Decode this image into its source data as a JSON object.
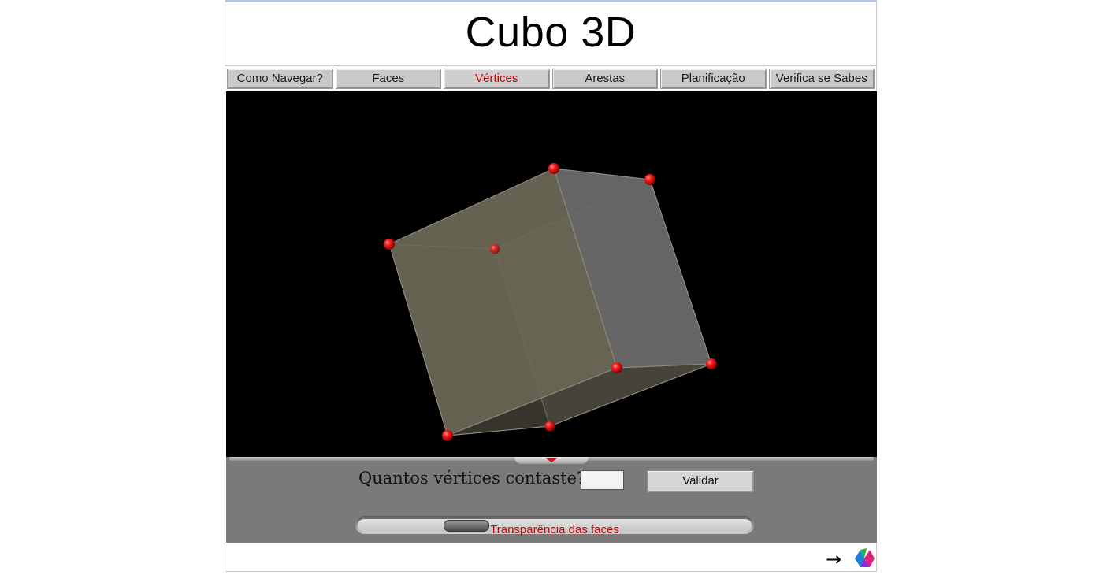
{
  "app": {
    "title": "Cubo 3D"
  },
  "nav": {
    "tabs": [
      {
        "label": "Como Navegar?",
        "active": false
      },
      {
        "label": "Faces",
        "active": false
      },
      {
        "label": "Vértices",
        "active": true
      },
      {
        "label": "Arestas",
        "active": false
      },
      {
        "label": "Planificação",
        "active": false
      },
      {
        "label": "Verifica se Sabes",
        "active": false
      }
    ]
  },
  "quiz": {
    "question": "Quantos vértices contaste?",
    "answer_value": "",
    "validate_label": "Validar"
  },
  "transparency": {
    "label": "Transparência das faces"
  },
  "footer": {
    "arrow": "→",
    "logo_icon": "colored-diamonds-logo-icon"
  },
  "colors": {
    "active_tab_text": "#c80000",
    "vertex_marker": "#e01010",
    "viewer_background": "#000000",
    "panel_background": "#7a7a7a"
  }
}
